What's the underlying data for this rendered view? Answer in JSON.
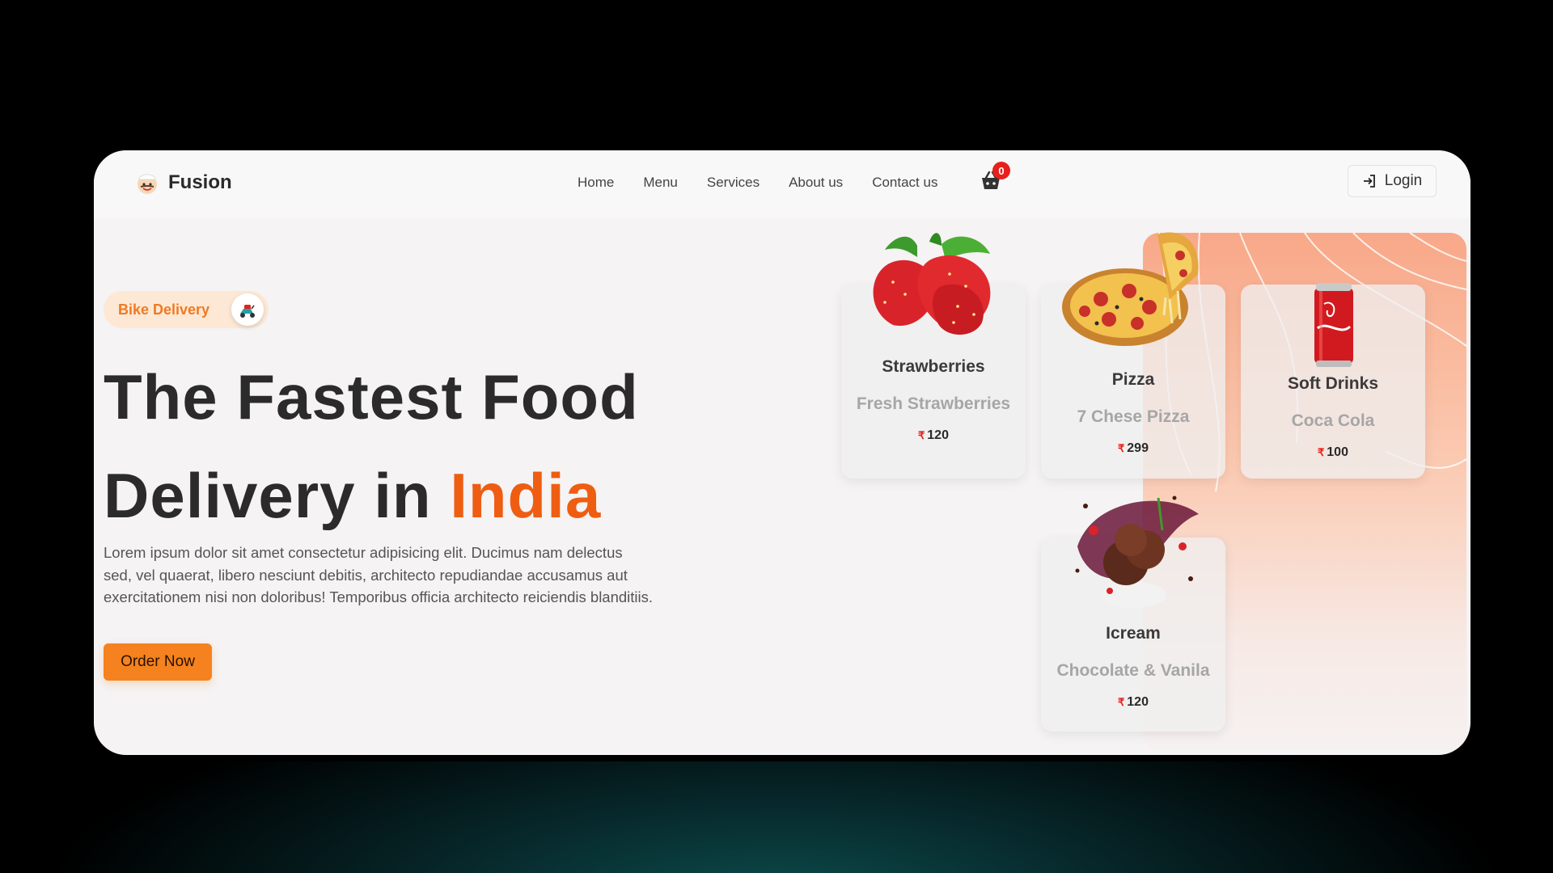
{
  "nav": {
    "brand": "Fusion",
    "links": [
      "Home",
      "Menu",
      "Services",
      "About us",
      "Contact us"
    ],
    "cart_count": "0",
    "login_label": "Login"
  },
  "hero": {
    "badge": "Bike Delivery",
    "title_line1": "The Fastest Food",
    "title_line2_prefix": "Delivery in",
    "title_highlight": "India",
    "description": "Lorem ipsum dolor sit amet consectetur adipisicing elit. Ducimus nam delectus sed, vel quaerat, libero nesciunt debitis, architecto repudiandae accusamus aut exercitationem nisi non doloribus! Temporibus officia architecto reiciendis blanditiis.",
    "cta": "Order Now"
  },
  "currency_symbol": "₹",
  "cards": [
    {
      "name": "Strawberries",
      "desc": "Fresh Strawberries",
      "price": "120",
      "icon": "strawberry-icon"
    },
    {
      "name": "Pizza",
      "desc": "7 Chese Pizza",
      "price": "299",
      "icon": "pizza-icon"
    },
    {
      "name": "Soft Drinks",
      "desc": "Coca Cola",
      "price": "100",
      "icon": "soda-can-icon"
    },
    {
      "name": "Icream",
      "desc": "Chocolate & Vanila",
      "price": "120",
      "icon": "ice-cream-icon"
    }
  ],
  "colors": {
    "accent": "#ee5d12",
    "button": "#f5821f",
    "badge_bg": "#fde8d6",
    "cart_badge": "#e8201c",
    "panel_top": "#f8a888"
  }
}
